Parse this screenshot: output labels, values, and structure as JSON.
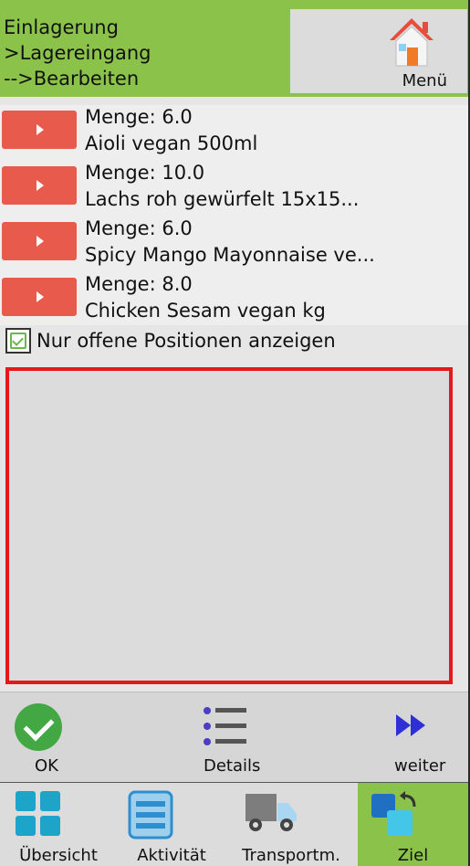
{
  "header": {
    "title": "Einlagerung\n>Lagereingang\n-->Bearbeiten",
    "menu_label": "Menü"
  },
  "items": [
    {
      "qty": "Menge: 6.0",
      "name": "Aioli vegan 500ml"
    },
    {
      "qty": "Menge: 10.0",
      "name": "Lachs roh gewürfelt 15x15..."
    },
    {
      "qty": "Menge: 6.0",
      "name": "Spicy Mango Mayonnaise ve..."
    },
    {
      "qty": "Menge: 8.0",
      "name": "Chicken Sesam vegan kg"
    }
  ],
  "filter": {
    "label": "Nur offene Positionen anzeigen",
    "checked": true
  },
  "actions": {
    "ok": "OK",
    "details": "Details",
    "weiter": "weiter"
  },
  "nav": {
    "tabs": [
      {
        "label": "Übersicht",
        "icon": "grid-icon"
      },
      {
        "label": "Aktivität",
        "icon": "list-icon"
      },
      {
        "label": "Transportm.",
        "icon": "truck-icon"
      },
      {
        "label": "Ziel",
        "icon": "target-icon",
        "active": true
      }
    ]
  },
  "colors": {
    "accent_green": "#8bc34a",
    "play_red": "#e85a4b",
    "highlight_red": "#e41a1a",
    "ok_green": "#43a843",
    "icon_blue": "#1a9bc7"
  }
}
